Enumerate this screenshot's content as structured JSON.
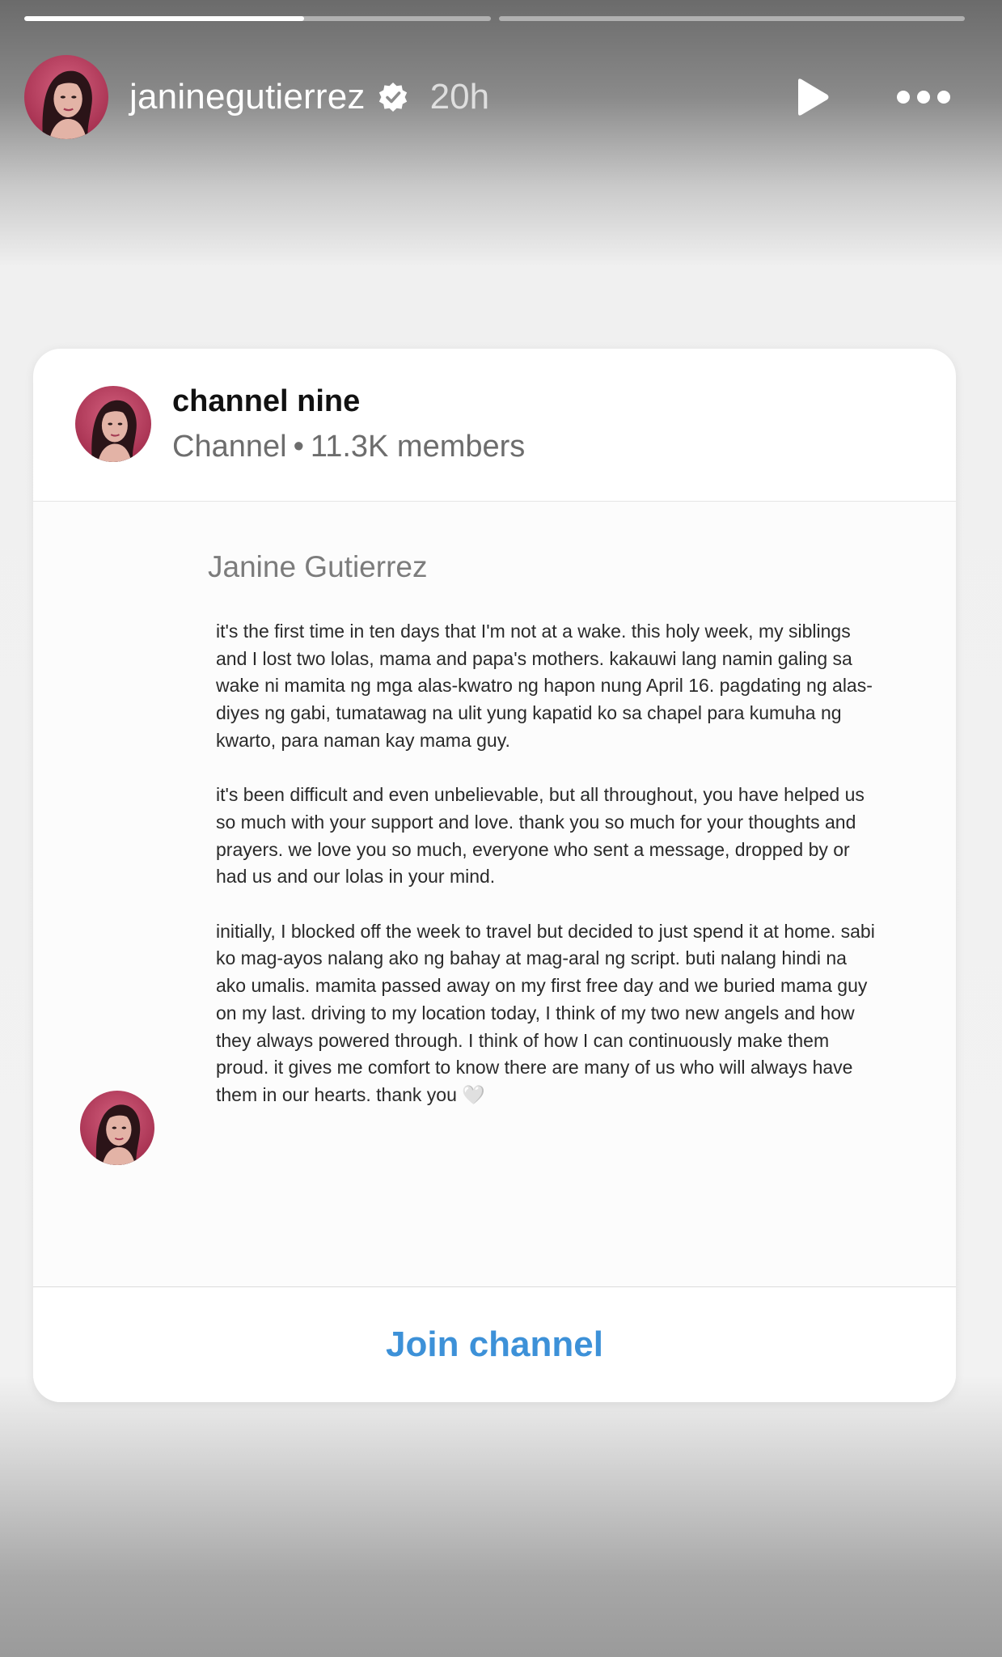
{
  "story": {
    "progress_segments": [
      {
        "fill": 0.6
      },
      {
        "fill": 0
      }
    ],
    "username": "janinegutierrez",
    "time_ago": "20h",
    "icons": [
      "verified-badge-icon",
      "play-icon",
      "more-icon"
    ]
  },
  "card": {
    "channel_name": "channel nine",
    "channel_type": "Channel",
    "separator": "•",
    "members": "11.3K members",
    "letter": {
      "author": "Janine Gutierrez",
      "paragraphs": [
        "it's the first time in ten days that I'm not at a wake. this holy week, my siblings and I lost two lolas, mama and papa's mothers. kakauwi lang namin galing sa wake ni mamita ng mga alas-kwatro ng hapon nung April 16. pagdating ng alas-diyes ng gabi, tumatawag na ulit yung kapatid ko sa chapel para kumuha ng kwarto, para naman kay mama guy.",
        "it's been difficult and even unbelievable, but all throughout, you have helped us so much with your support and love. thank you so much for your thoughts and prayers. we love you so much, everyone who sent a message, dropped by or had us and our lolas in your mind.",
        "initially, I blocked off the week to travel but decided to just spend it at home. sabi ko mag-ayos nalang ako ng bahay at mag-aral ng script. buti nalang hindi na ako umalis. mamita passed away on my first free day and we buried mama guy on my last. driving to my location today, I think of my two new angels and how they always powered through. I think of how I can continuously make them proud. it gives me comfort to know there are many of us who will always have them in our hearts. thank you 🤍"
      ]
    },
    "join_label": "Join channel",
    "join_color": "#3d91d8"
  }
}
